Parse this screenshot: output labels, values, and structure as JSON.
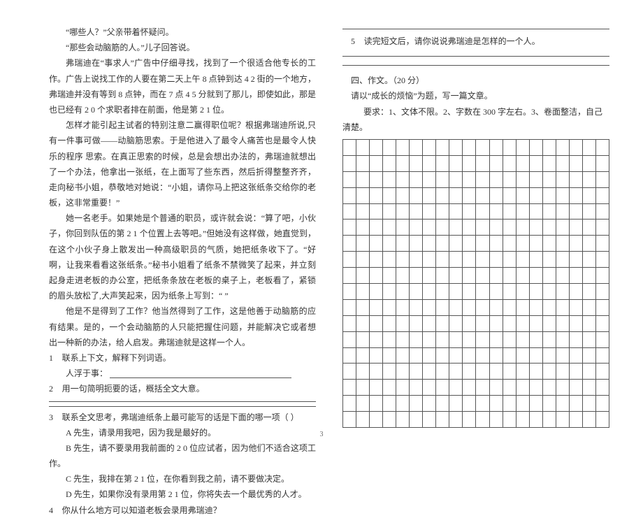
{
  "left_col": {
    "p1": "“哪些人？”父亲带着怀疑问。",
    "p2": "“那些会动脑筋的人。”儿子回答说。",
    "p3": "弗瑞迪在“事求人”广告中仔细寻找，找到了一个很适合他专长的工作。广告上说找工作的人要在第二天上午 8 点钟到达 4 2 街的一个地方，弗瑞迪并没有等到 8 点钟，而在 7 点 4 5 分就到了那儿，即使如此，那是也已经有 2 0 个求职者排在前面，他是第 2 1 位。",
    "p4": "怎样才能引起主试者的特别注意二赢得职位呢？根据弗瑞迪所说,只有一件事可做——动脑筋思索。于是他进入了最令人痛苦也是最令人快乐的程序 思索。在真正思索的时候，总是会想出办法的，弗瑞迪就想出了一个办法，他拿出一张纸，在上面写了些东西，然后折得整整齐齐，走向秘书小姐，恭敬地对她说：“小姐，请你马上把这张纸条交给你的老板，这非常重要！”",
    "p5": "她一名老手。如果她是个普通的职员，或许就会说：“算了吧，小伙子，你回到队伍的第 2 1 个位置上去等吧。”但她没有这样做，她直觉到，在这个小伙子身上散发出一种高级职员的气质，她把纸条收下了。“好啊，让我来看看这张纸条。”秘书小姐看了纸条不禁微笑了起来，并立刻起身走进老板的办公室，把纸条条放在老板的桌子上，老板看了，紧锁的眉头放松了,大声笑起来，因为纸条上写到：“                          ”",
    "p6": "他是不是得到了工作？他当然得到了工作，这是他善于动脑筋的应有结果。是的，一个会动脑筋的人只能把握住问题，并能解决它或者想出一种新的办法，给人启发。弗瑞迪就是这样一个人。",
    "q1_num": "1",
    "q1_text": "联系上下文，解释下列词语。",
    "q1_sub": "人浮于事：",
    "q2_num": "2",
    "q2_text": "用一句简明扼要的话，概括全文大意。",
    "q3_num": "3",
    "q3_text": "联系全文思考，弗瑞迪纸条上最可能写的话是下面的哪一项（    ）",
    "optA": "A 先生，请录用我吧，因为我是最好的。",
    "optB": "B 先生，请不要录用我前面的 2 0 位应试者，因为他们不适合这项工作。",
    "optC": "C 先生，我排在第 2 1 位，在你看到我之前，请不要做决定。",
    "optD": "D 先生，如果你没有录用第 2 1 位，你将失去一个最优秀的人才。",
    "q4_num": "4",
    "q4_text": "你从什么地方可以知道老板会录用弗瑞迪？"
  },
  "right_col": {
    "q5_num": "5",
    "q5_text": "读完短文后，请你说说弗瑞迪是怎样的一个人。",
    "section_title": "四、作文。（20 分）",
    "essay_prompt": "请以“成长的烦恼”为题，写一篇文章。",
    "essay_req": "要求：1、文体不限。2、字数在 300 字左右。3、卷面整洁，自己清楚。"
  },
  "grid": {
    "rows": 18,
    "cols": 20
  },
  "page_number": "3"
}
